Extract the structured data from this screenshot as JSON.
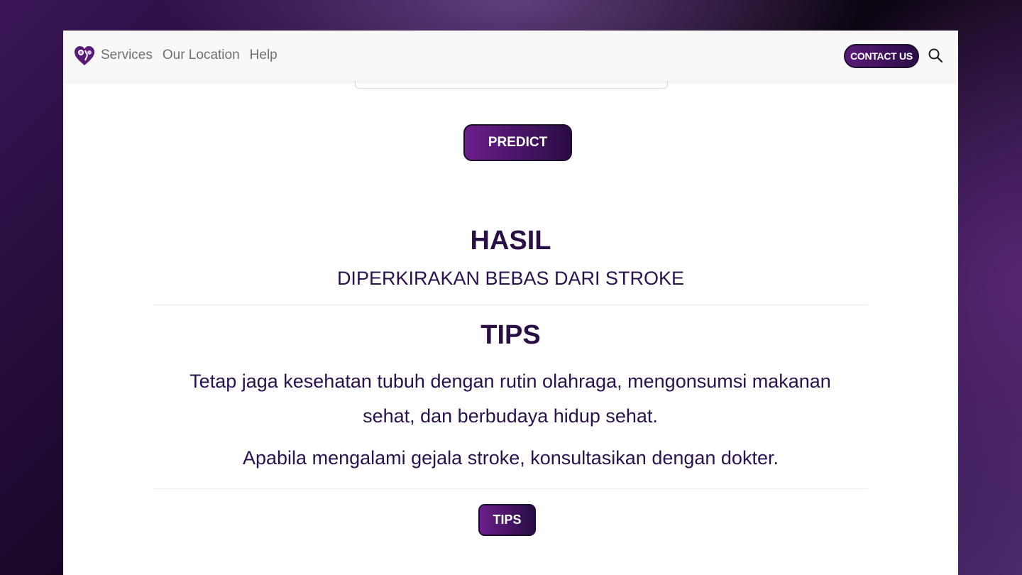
{
  "nav": {
    "logo_icon": "heart-brain-icon",
    "links": [
      "Services",
      "Our Location",
      "Help"
    ],
    "contact_label": "CONTACT US",
    "search_icon": "search-icon"
  },
  "form": {
    "predict_label": "PREDICT"
  },
  "result": {
    "title": "HASIL",
    "value": "DIPERKIRAKAN BEBAS DARI STROKE"
  },
  "tips": {
    "title": "TIPS",
    "text": "Tetap jaga kesehatan tubuh dengan rutin olahraga, mengonsumsi makanan sehat, dan berbudaya hidup sehat.",
    "advice": "Apabila mengalami gejala stroke, konsultasikan dengan dokter.",
    "button_label": "TIPS"
  },
  "colors": {
    "accent": "#5a1a78",
    "text": "#2a0f44"
  }
}
